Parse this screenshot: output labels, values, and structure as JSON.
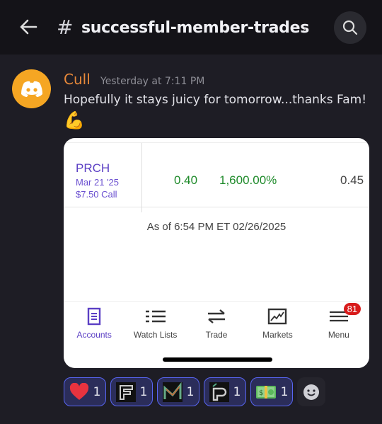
{
  "header": {
    "channel": "successful-member-trades",
    "hash": "#",
    "chevron": "›"
  },
  "message": {
    "author": "Cull",
    "timestamp": "Yesterday at 7:11 PM",
    "text": "Hopefully it stays juicy for tomorrow...thanks Fam!",
    "emoji": "💪"
  },
  "card": {
    "symbol": "PRCH",
    "expiry": "Mar 21 '25",
    "strike": "$7.50 Call",
    "value1": "0.40",
    "change": "1,600.00%",
    "value3": "0.45",
    "as_of": "As of 6:54 PM ET 02/26/2025",
    "tabs": [
      {
        "label": "Accounts",
        "icon": "document-icon"
      },
      {
        "label": "Watch Lists",
        "icon": "list-icon"
      },
      {
        "label": "Trade",
        "icon": "swap-arrows-icon"
      },
      {
        "label": "Markets",
        "icon": "chart-icon"
      },
      {
        "label": "Menu",
        "icon": "hamburger-icon"
      }
    ],
    "menu_badge": "81"
  },
  "reactions": [
    {
      "emoji": "heart",
      "count": "1"
    },
    {
      "emoji": "F-logo",
      "count": "1"
    },
    {
      "emoji": "M-logo",
      "count": "1"
    },
    {
      "emoji": "P-logo",
      "count": "1"
    },
    {
      "emoji": "money",
      "count": "1"
    }
  ],
  "colors": {
    "accent": "#5b3fc4",
    "positive": "#1e8a2a",
    "username": "#e8893a",
    "reaction_border": "#5865f2"
  }
}
